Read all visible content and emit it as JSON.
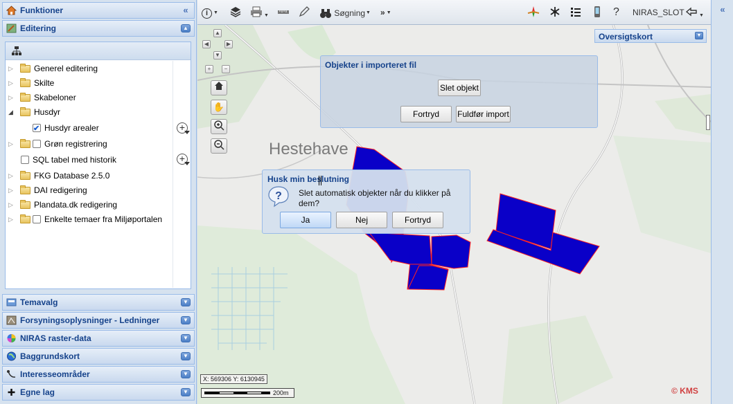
{
  "left_panel": {
    "funktioner": {
      "label": "Funktioner"
    },
    "editering": {
      "label": "Editering"
    },
    "tree": [
      {
        "label": "Generel editering"
      },
      {
        "label": "Skilte"
      },
      {
        "label": "Skabeloner"
      },
      {
        "label": "Husdyr"
      },
      {
        "label": "Husdyr arealer"
      },
      {
        "label": "Grøn registrering"
      },
      {
        "label": "SQL tabel med historik"
      },
      {
        "label": "FKG Database 2.5.0"
      },
      {
        "label": "DAI redigering"
      },
      {
        "label": "Plandata.dk redigering"
      },
      {
        "label": "Enkelte temaer fra Miljøportalen"
      }
    ],
    "sections": [
      {
        "label": "Temavalg"
      },
      {
        "label": "Forsyningsoplysninger - Ledninger"
      },
      {
        "label": "NIRAS raster-data"
      },
      {
        "label": "Baggrundskort"
      },
      {
        "label": "Interesseområder"
      },
      {
        "label": "Egne lag"
      }
    ]
  },
  "toolbar": {
    "search_label": "Søgning",
    "more_label": "»",
    "user_label": "NIRAS_SLOT"
  },
  "map": {
    "overview_label": "Oversigtskort",
    "place_label": "Hestehave",
    "coords_label": "X: 569306 Y: 6130945",
    "scale_label": "200m",
    "copyright": "© KMS",
    "polygon_fill": "#0a00c8",
    "polygon_stroke": "#ff2020"
  },
  "import_window": {
    "title": "Objekter i importeret fil",
    "delete_button": "Slet objekt",
    "cancel_button": "Fortryd",
    "finish_button": "Fuldfør import"
  },
  "confirm_dialog": {
    "title": "Husk min beslutning",
    "message": "Slet automatisk objekter når du klikker på dem?",
    "yes_button": "Ja",
    "no_button": "Nej",
    "cancel_button": "Fortryd"
  }
}
